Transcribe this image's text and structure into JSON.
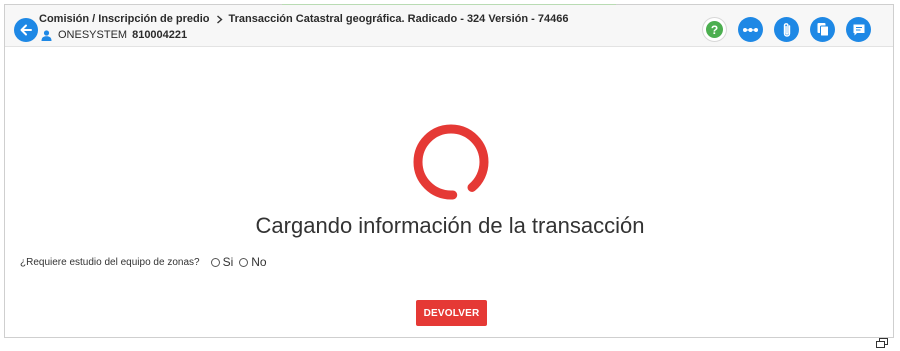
{
  "header": {
    "breadcrumb": {
      "parent": "Comisión / Inscripción de predio",
      "current": "Transacción Catastral geográfica. Radicado - 324 Versión - 74466"
    },
    "user": {
      "name": "ONESYSTEM",
      "id": "810004221"
    },
    "actions": {
      "help_glyph": "?",
      "icons": [
        "help-icon",
        "more-horizontal-icon",
        "attachment-icon",
        "documents-icon",
        "comments-icon"
      ]
    }
  },
  "main": {
    "loading_text": "Cargando información de la transacción",
    "question": {
      "label": "¿Requiere estudio del equipo de zonas?",
      "options": [
        "Si",
        "No"
      ]
    },
    "devolver_label": "DEVOLVER"
  },
  "colors": {
    "primary": "#1e88e5",
    "danger": "#e53935",
    "help": "#4caf50",
    "spinner": "#e53935"
  }
}
